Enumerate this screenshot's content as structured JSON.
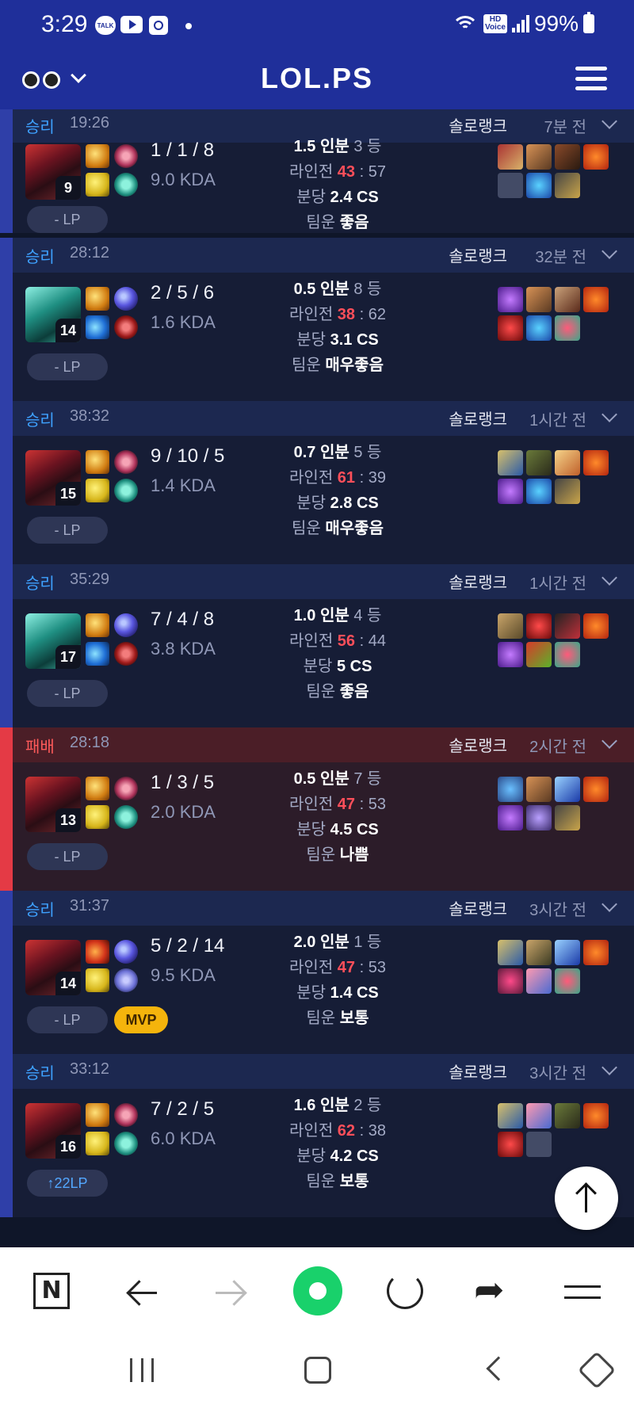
{
  "status_bar": {
    "time": "3:29",
    "talk_label": "TALK",
    "battery": "99%",
    "icons": [
      "talk-icon",
      "youtube-icon",
      "calendar-icon",
      "dot-icon",
      "wifi-icon",
      "hd-voice-icon",
      "signal-icon",
      "battery-icon"
    ]
  },
  "header": {
    "title": "LOL.PS",
    "icons": [
      "binoculars-icon",
      "chevron-down-icon",
      "menu-icon"
    ]
  },
  "matches": [
    {
      "result": "승리",
      "duration": "19:26",
      "queue": "솔로랭크",
      "ago": "7분 전",
      "champion_level": "9",
      "kda": "1 / 1 / 8",
      "kda_ratio": "9.0 KDA",
      "lp": "- LP",
      "mvp": "",
      "share_value": "1.5 인분",
      "rank": "3 등",
      "lane_label": "라인전",
      "lane_win": "43",
      "lane_lose": "57",
      "cs_label": "분당",
      "cs": "2.4 CS",
      "luck_label": "팀운",
      "luck": "좋음"
    },
    {
      "result": "승리",
      "duration": "28:12",
      "queue": "솔로랭크",
      "ago": "32분 전",
      "champion_level": "14",
      "kda": "2 / 5 / 6",
      "kda_ratio": "1.6 KDA",
      "lp": "- LP",
      "mvp": "",
      "share_value": "0.5 인분",
      "rank": "8 등",
      "lane_label": "라인전",
      "lane_win": "38",
      "lane_lose": "62",
      "cs_label": "분당",
      "cs": "3.1 CS",
      "luck_label": "팀운",
      "luck": "매우좋음"
    },
    {
      "result": "승리",
      "duration": "38:32",
      "queue": "솔로랭크",
      "ago": "1시간 전",
      "champion_level": "15",
      "kda": "9 / 10 / 5",
      "kda_ratio": "1.4 KDA",
      "lp": "- LP",
      "mvp": "",
      "share_value": "0.7 인분",
      "rank": "5 등",
      "lane_label": "라인전",
      "lane_win": "61",
      "lane_lose": "39",
      "cs_label": "분당",
      "cs": "2.8 CS",
      "luck_label": "팀운",
      "luck": "매우좋음"
    },
    {
      "result": "승리",
      "duration": "35:29",
      "queue": "솔로랭크",
      "ago": "1시간 전",
      "champion_level": "17",
      "kda": "7 / 4 / 8",
      "kda_ratio": "3.8 KDA",
      "lp": "- LP",
      "mvp": "",
      "share_value": "1.0 인분",
      "rank": "4 등",
      "lane_label": "라인전",
      "lane_win": "56",
      "lane_lose": "44",
      "cs_label": "분당",
      "cs": "5 CS",
      "luck_label": "팀운",
      "luck": "좋음"
    },
    {
      "result": "패배",
      "duration": "28:18",
      "queue": "솔로랭크",
      "ago": "2시간 전",
      "champion_level": "13",
      "kda": "1 / 3 / 5",
      "kda_ratio": "2.0 KDA",
      "lp": "- LP",
      "mvp": "",
      "share_value": "0.5 인분",
      "rank": "7 등",
      "lane_label": "라인전",
      "lane_win": "47",
      "lane_lose": "53",
      "cs_label": "분당",
      "cs": "4.5 CS",
      "luck_label": "팀운",
      "luck": "나쁨"
    },
    {
      "result": "승리",
      "duration": "31:37",
      "queue": "솔로랭크",
      "ago": "3시간 전",
      "champion_level": "14",
      "kda": "5 / 2 / 14",
      "kda_ratio": "9.5 KDA",
      "lp": "- LP",
      "mvp": "MVP",
      "share_value": "2.0 인분",
      "rank": "1 등",
      "lane_label": "라인전",
      "lane_win": "47",
      "lane_lose": "53",
      "cs_label": "분당",
      "cs": "1.4 CS",
      "luck_label": "팀운",
      "luck": "보통"
    },
    {
      "result": "승리",
      "duration": "33:12",
      "queue": "솔로랭크",
      "ago": "3시간 전",
      "champion_level": "16",
      "kda": "7 / 2 / 5",
      "kda_ratio": "6.0 KDA",
      "lp": "↑22LP",
      "mvp": "",
      "share_value": "1.6 인분",
      "rank": "2 등",
      "lane_label": "라인전",
      "lane_win": "62",
      "lane_lose": "38",
      "cs_label": "분당",
      "cs": "4.2 CS",
      "luck_label": "팀운",
      "luck": "보통"
    }
  ],
  "browser_bar": {
    "icons": [
      "naver-icon",
      "back-arrow-icon",
      "forward-arrow-icon",
      "home-icon",
      "reload-icon",
      "share-icon",
      "more-menu-icon"
    ],
    "naver_label": "N"
  },
  "system_nav": {
    "icons": [
      "recents-icon",
      "home-button-icon",
      "back-button-icon",
      "rotate-icon"
    ]
  },
  "colors": {
    "header_bg": "#1f2f9a",
    "list_bg": "#0f1629",
    "win_accent": "#3ea1ff",
    "loss_accent": "#ff5a5a",
    "lane_value": "#ff4f5a",
    "mvp_badge": "#f5b40c",
    "home_button": "#19d16b"
  }
}
